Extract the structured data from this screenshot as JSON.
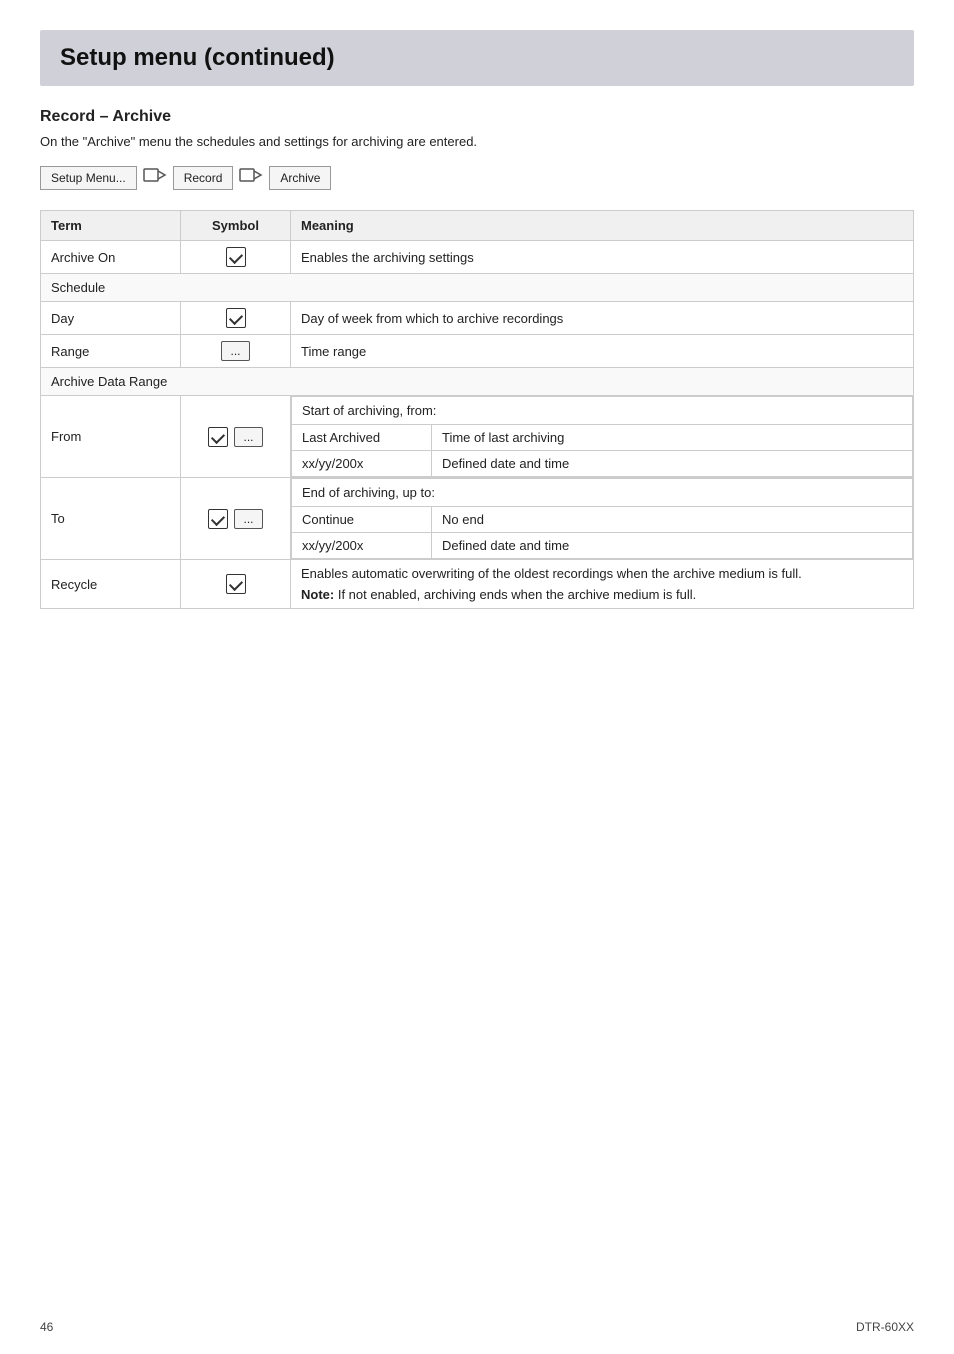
{
  "header": {
    "title": "Setup menu (continued)"
  },
  "section": {
    "title": "Record – Archive",
    "description": "On the \"Archive\" menu the schedules and settings for archiving are entered."
  },
  "breadcrumb": {
    "items": [
      "Setup Menu...",
      "Record",
      "Archive"
    ]
  },
  "table": {
    "columns": [
      "Term",
      "Symbol",
      "Meaning"
    ],
    "rows": [
      {
        "term": "Archive On",
        "symbol": "checkbox",
        "meaning_simple": "Enables the archiving settings",
        "type": "simple"
      },
      {
        "term": "Schedule",
        "symbol": "",
        "meaning_simple": "",
        "type": "group-header"
      },
      {
        "term": "Day",
        "symbol": "checkbox",
        "meaning_simple": "Day of week from which to archive recordings",
        "type": "simple"
      },
      {
        "term": "Range",
        "symbol": "ellipsis",
        "meaning_simple": "Time range",
        "type": "simple"
      },
      {
        "term": "Archive Data Range",
        "symbol": "",
        "meaning_simple": "",
        "type": "group-header"
      },
      {
        "term": "From",
        "symbol": "checkbox-ellipsis",
        "type": "complex",
        "meaning_header": "Start of archiving, from:",
        "sub_rows": [
          {
            "label": "Last Archived",
            "meaning": "Time of last archiving"
          },
          {
            "label": "xx/yy/200x",
            "meaning": "Defined date and time"
          }
        ]
      },
      {
        "term": "To",
        "symbol": "checkbox-ellipsis",
        "type": "complex",
        "meaning_header": "End of archiving, up to:",
        "sub_rows": [
          {
            "label": "Continue",
            "meaning": "No end"
          },
          {
            "label": "xx/yy/200x",
            "meaning": "Defined date and time"
          }
        ]
      },
      {
        "term": "Recycle",
        "symbol": "checkbox",
        "type": "recycle",
        "meaning_line1": "Enables automatic overwriting of the oldest recordings when the archive medium is full.",
        "note_label": "Note:",
        "note_text": " If not enabled, archiving ends when the archive medium is full."
      }
    ]
  },
  "footer": {
    "page_number": "46",
    "model": "DTR-60XX"
  }
}
